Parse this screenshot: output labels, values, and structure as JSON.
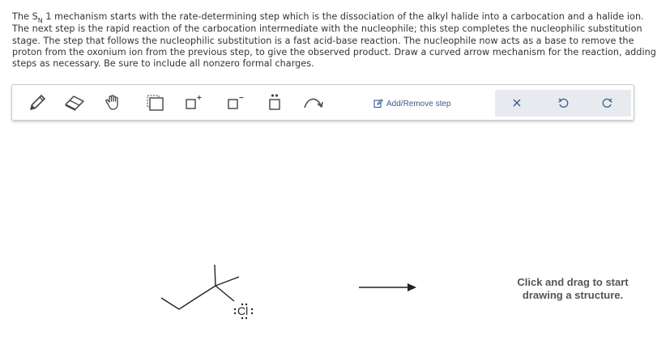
{
  "question": {
    "lead": "The S",
    "subscript": "N",
    "text_1": "1 mechanism starts with the rate-determining step which is the dissociation of the alkyl halide into a carbocation and a halide ion. The next step is the rapid reaction of the carbocation intermediate with the nucleophile; this step completes the nucleophilic substitution stage. The step that follows the nucleophilic substitution is a fast acid-base reaction. The nucleophile now acts as a base to remove the proton from the oxonium ion from the previous step, to give the observed product. Draw a curved arrow mechanism for the reaction, adding steps as necessary. Be sure to include all nonzero formal charges."
  },
  "toolbar": {
    "add_remove_label": "Add/Remove step",
    "plus_charge": "+",
    "minus_charge": "−",
    "icons": [
      "pencil-icon",
      "eraser-icon",
      "hand-icon",
      "select-box-icon",
      "positive-charge-icon",
      "negative-charge-icon",
      "lone-pair-icon",
      "curved-arrow-icon",
      "edit-icon",
      "close-icon",
      "undo-icon",
      "redo-icon"
    ]
  },
  "canvas": {
    "atom_label": "Cl",
    "hint": "Click and drag to start\ndrawing a structure."
  },
  "colors": {
    "accent": "#3a5a8f",
    "panel": "#e7eaee",
    "text": "#333333"
  }
}
